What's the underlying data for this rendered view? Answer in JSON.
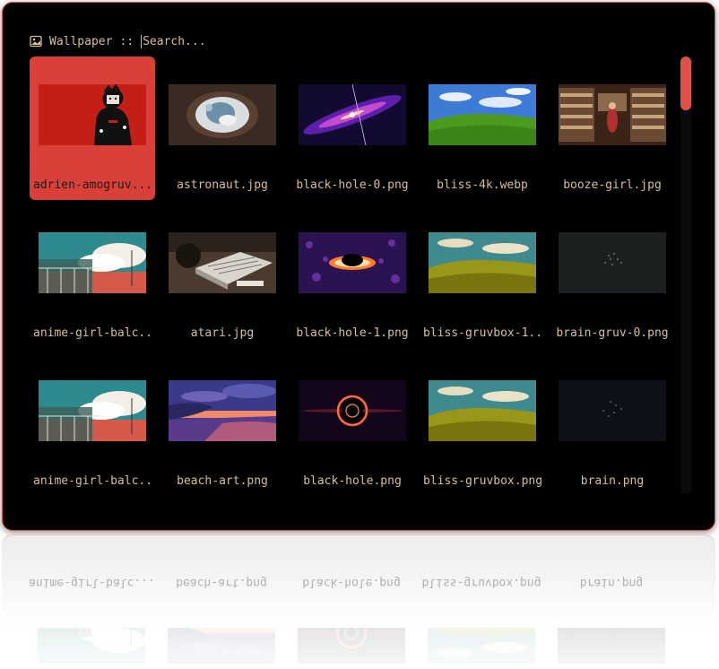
{
  "search": {
    "title": "Wallpaper",
    "separator": "::",
    "placeholder": "Search..."
  },
  "colors": {
    "accent": "#e0514c",
    "selected_tile": "#d9403a",
    "text": "#d9bf93",
    "background": "#000000"
  },
  "wallpapers": [
    {
      "label": "adrien-amogruv....",
      "thumb": "red-character",
      "selected": true
    },
    {
      "label": "astronaut.jpg",
      "thumb": "astronaut"
    },
    {
      "label": "black-hole-0.png",
      "thumb": "galaxy-purple"
    },
    {
      "label": "bliss-4k.webp",
      "thumb": "bliss"
    },
    {
      "label": "booze-girl.jpg",
      "thumb": "store-shelves"
    },
    {
      "label": "anime-girl-balc...",
      "thumb": "anime-balcony"
    },
    {
      "label": "atari.jpg",
      "thumb": "atari"
    },
    {
      "label": "black-hole-1.png",
      "thumb": "black-hole-ring"
    },
    {
      "label": "bliss-gruvbox-1...",
      "thumb": "bliss-gruvbox"
    },
    {
      "label": "brain-gruv-0.png",
      "thumb": "dark-dots"
    },
    {
      "label": "anime-girl-balc...",
      "thumb": "anime-balcony"
    },
    {
      "label": "beach-art.png",
      "thumb": "beach-sunset"
    },
    {
      "label": "black-hole.png",
      "thumb": "black-hole-dark"
    },
    {
      "label": "bliss-gruvbox.png",
      "thumb": "bliss-gruvbox"
    },
    {
      "label": "brain.png",
      "thumb": "dark-dots-2"
    }
  ],
  "scrollbar": {
    "position": 0.0
  }
}
